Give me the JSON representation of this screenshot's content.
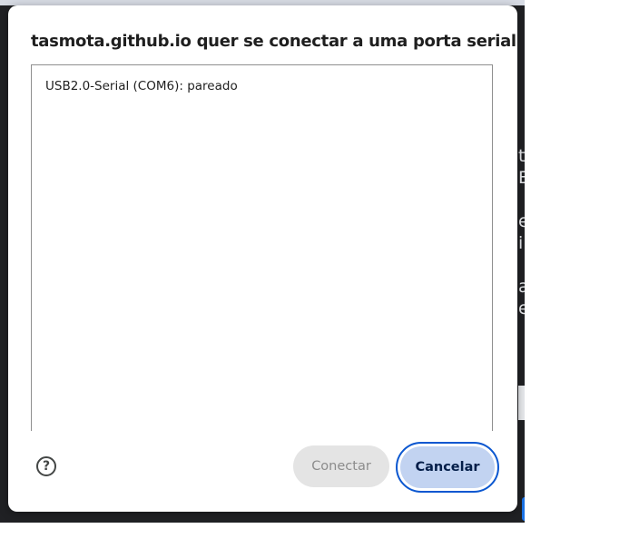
{
  "dialog": {
    "title": "tasmota.github.io quer se conectar a uma porta serial",
    "devices": [
      {
        "label": "USB2.0-Serial (COM6): pareado"
      }
    ],
    "help_glyph": "?",
    "help_icon": "help-circle-icon",
    "connect_label": "Conectar",
    "cancel_label": "Cancelar"
  },
  "colors": {
    "backdrop": "#202124",
    "dialog_bg": "#ffffff",
    "connect_disabled_bg": "#e4e4e4",
    "cancel_bg": "#c2d3f1",
    "focus_ring": "#0b57d0"
  }
}
